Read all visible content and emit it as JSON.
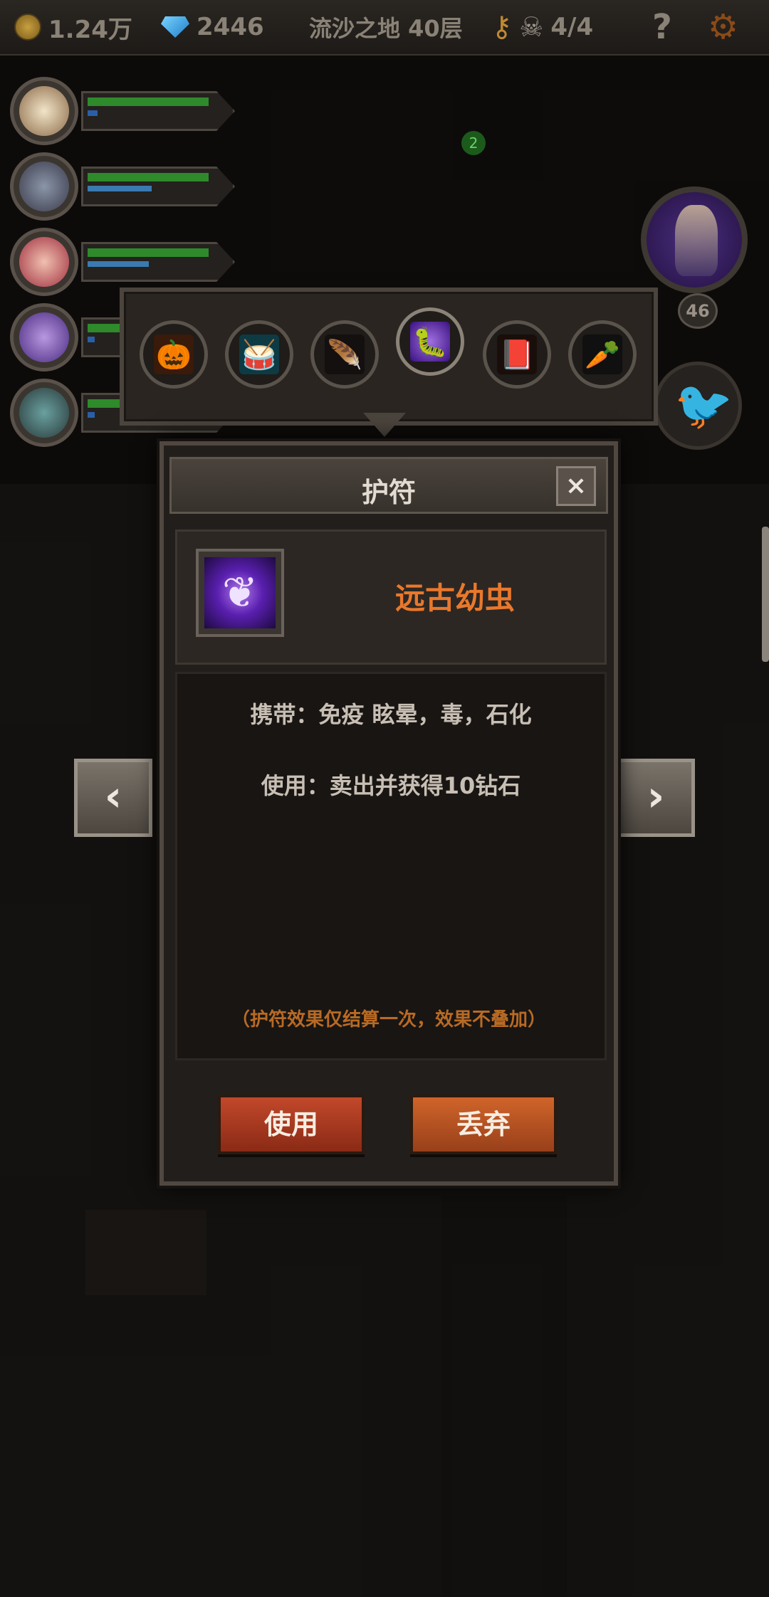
{
  "hud": {
    "gold": "1.24万",
    "diamonds": "2446",
    "location": "流沙之地 40层",
    "keys_icon": "key-icon",
    "kills": "4/4",
    "help": "?",
    "settings_icon": "gear-icon"
  },
  "map": {
    "marker": "2",
    "boss_level": "46"
  },
  "item_strip": [
    {
      "name": "pumpkin",
      "icon": "🎃"
    },
    {
      "name": "drum",
      "icon": "🥁"
    },
    {
      "name": "feather",
      "icon": "🪶"
    },
    {
      "name": "ancient-larva",
      "icon": "🐛"
    },
    {
      "name": "book",
      "icon": "📕"
    },
    {
      "name": "carrot",
      "icon": "🥕"
    }
  ],
  "modal": {
    "title": "护符",
    "close": "×",
    "item_name": "远古幼虫",
    "carry_text": "携带：免疫 眩晕，毒，石化",
    "use_text": "使用：卖出并获得10钻石",
    "note": "（护符效果仅结算一次，效果不叠加）",
    "use_button": "使用",
    "drop_button": "丢弃"
  },
  "colors": {
    "item_name": "#e9782c",
    "use_button": "#c2482a",
    "drop_button": "#d0642a",
    "note": "#b86a24"
  }
}
